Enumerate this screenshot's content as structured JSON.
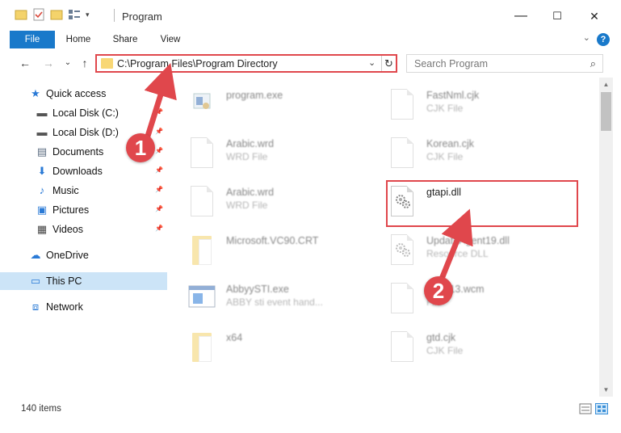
{
  "window": {
    "title": "Program",
    "minimize": "—",
    "maximize": "☐",
    "close": "✕"
  },
  "ribbon": {
    "tabs": [
      "File",
      "Home",
      "Share",
      "View"
    ],
    "help": "?",
    "collapse": "⌄"
  },
  "nav": {
    "back": "←",
    "forward": "→",
    "recent": "⌄",
    "up": "↑",
    "address": "C:\\Program Files\\Program Directory",
    "address_dropdown": "⌄",
    "refresh": "↻",
    "search_placeholder": "Search Program",
    "search_icon": "⌕"
  },
  "sidebar": {
    "items": [
      {
        "label": "Quick access",
        "icon": "star-icon",
        "glyph": "★",
        "color": "#2a7ad6",
        "pinned": false
      },
      {
        "label": "Local Disk (C:)",
        "icon": "drive-icon",
        "glyph": "▬",
        "color": "#555555",
        "pinned": true
      },
      {
        "label": "Local Disk (D:)",
        "icon": "drive-icon",
        "glyph": "▬",
        "color": "#555555",
        "pinned": true
      },
      {
        "label": "Documents",
        "icon": "documents-icon",
        "glyph": "▤",
        "color": "#5a6b80",
        "pinned": true
      },
      {
        "label": "Downloads",
        "icon": "download-icon",
        "glyph": "⬇",
        "color": "#2a7ad6",
        "pinned": true
      },
      {
        "label": "Music",
        "icon": "music-icon",
        "glyph": "♪",
        "color": "#2a7ad6",
        "pinned": true
      },
      {
        "label": "Pictures",
        "icon": "pictures-icon",
        "glyph": "▣",
        "color": "#2a7ad6",
        "pinned": true
      },
      {
        "label": "Videos",
        "icon": "videos-icon",
        "glyph": "▦",
        "color": "#444444",
        "pinned": true
      },
      {
        "label": "OneDrive",
        "icon": "cloud-icon",
        "glyph": "☁",
        "color": "#2a7ad6",
        "pinned": false
      },
      {
        "label": "This PC",
        "icon": "computer-icon",
        "glyph": "▭",
        "color": "#2a7ad6",
        "pinned": false
      },
      {
        "label": "Network",
        "icon": "network-icon",
        "glyph": "⧈",
        "color": "#2a7ad6",
        "pinned": false
      }
    ]
  },
  "files": [
    {
      "name": "program.exe",
      "type": "",
      "icon": "exe-icon"
    },
    {
      "name": "FastNml.cjk",
      "type": "CJK File",
      "icon": "document-icon"
    },
    {
      "name": "Arabic.wrd",
      "type": "WRD File",
      "icon": "document-icon"
    },
    {
      "name": "Korean.cjk",
      "type": "CJK File",
      "icon": "document-icon"
    },
    {
      "name": "Arabic.wrd",
      "type": "WRD File",
      "icon": "document-icon"
    },
    {
      "name": "gtapi.dll",
      "type": "",
      "icon": "dll-gear-icon"
    },
    {
      "name": "Microsoft.VC90.CRT",
      "type": "",
      "icon": "folder-icon"
    },
    {
      "name": "UpdateAgent19.dll",
      "type": "Resource DLL",
      "icon": "dll-gear-icon"
    },
    {
      "name": "AbbyySTI.exe",
      "type": "ABBY sti event hand...",
      "icon": "exe-window-icon"
    },
    {
      "name": "SWP13.wcm",
      "type": "File",
      "icon": "document-icon"
    },
    {
      "name": "x64",
      "type": "",
      "icon": "folder-icon"
    },
    {
      "name": "gtd.cjk",
      "type": "CJK File",
      "icon": "document-icon"
    }
  ],
  "status": {
    "items_count": "140 items"
  },
  "callouts": [
    "1",
    "2"
  ],
  "colors": {
    "accent": "#1979ca",
    "highlight": "#e0474c",
    "selected": "#cce4f7",
    "folder": "#f4d36b"
  }
}
